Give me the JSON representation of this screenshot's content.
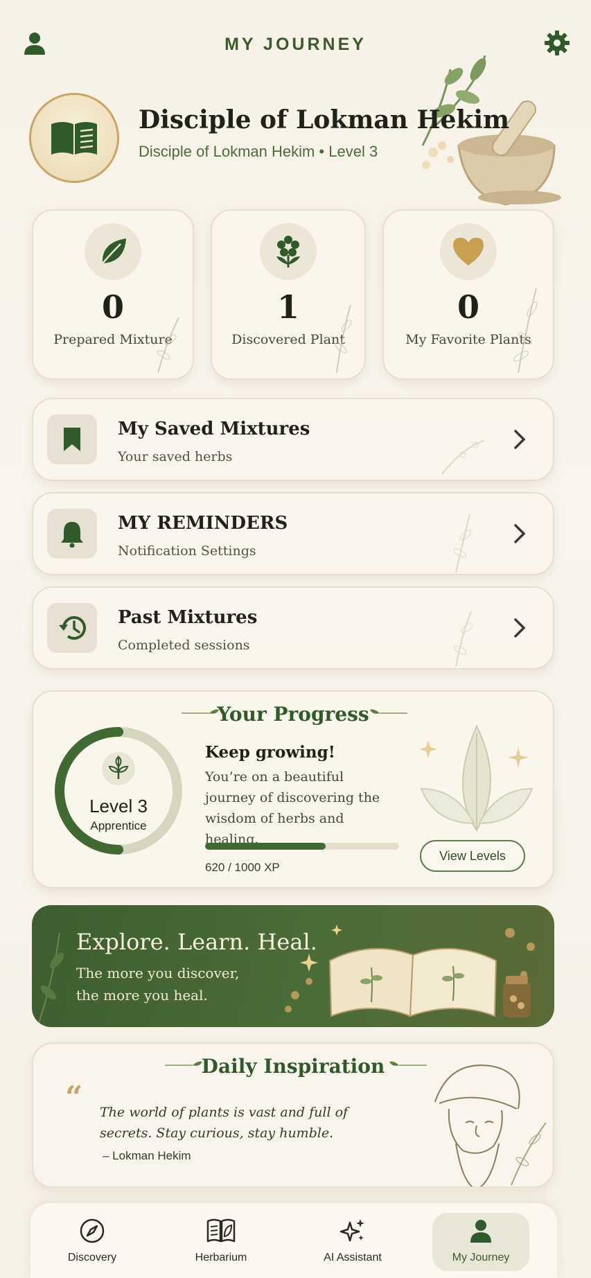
{
  "header": {
    "title": "MY JOURNEY",
    "profile_icon": "user-icon",
    "settings_icon": "gear-icon"
  },
  "profile": {
    "name": "Disciple of Lokman Hekim",
    "subtitle": "Disciple of Lokman Hekim • Level 3",
    "avatar_icon": "open-book-icon"
  },
  "stats": [
    {
      "value": "0",
      "label": "Prepared Mixture",
      "icon": "leaf-icon"
    },
    {
      "value": "1",
      "label": "Discovered Plant",
      "icon": "flower-icon"
    },
    {
      "value": "0",
      "label": "My Favorite Plants",
      "icon": "heart-icon"
    }
  ],
  "menu": [
    {
      "title": "My Saved Mixtures",
      "subtitle": "Your saved herbs",
      "icon": "bookmark-icon"
    },
    {
      "title": "MY REMINDERS",
      "subtitle": "Notification Settings",
      "icon": "bell-icon"
    },
    {
      "title": "Past Mixtures",
      "subtitle": "Completed sessions",
      "icon": "history-icon"
    }
  ],
  "progress": {
    "section_title": "Your Progress",
    "level": "Level 3",
    "rank": "Apprentice",
    "headline": "Keep growing!",
    "description": "You’re on a beautiful journey of discovering the wisdom of herbs and healing.",
    "xp_text": "620 / 1000 XP",
    "xp_fraction": 0.62,
    "ring_fraction": 0.5,
    "button": "View Levels"
  },
  "banner": {
    "title": "Explore. Learn. Heal.",
    "subtitle": "The more you discover, the more you heal."
  },
  "inspiration": {
    "section_title": "Daily Inspiration",
    "quote": "The world of plants is vast and full of secrets. Stay curious, stay humble.",
    "author": "– Lokman Hekim"
  },
  "nav": [
    {
      "label": "Discovery",
      "icon": "compass-icon"
    },
    {
      "label": "Herbarium",
      "icon": "book-leaf-icon"
    },
    {
      "label": "AI Assistant",
      "icon": "sparkles-icon"
    },
    {
      "label": "My Journey",
      "icon": "user-icon",
      "active": true
    }
  ],
  "colors": {
    "accent_green": "#3c5a2c",
    "gold": "#c9a466",
    "background": "#f7f2e6"
  }
}
